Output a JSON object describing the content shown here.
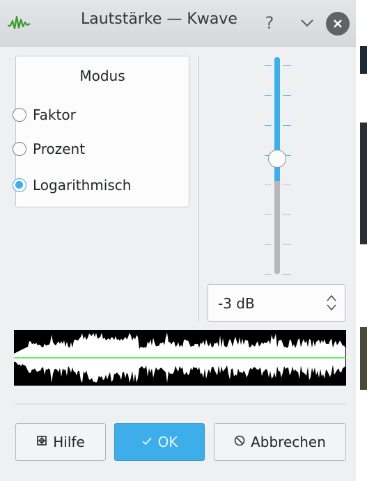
{
  "window": {
    "title": "Lautstärke — Kwave",
    "help_symbol": "?",
    "minimize_symbol": "⌄",
    "close_symbol": "✕",
    "icon": "kwave-waveform-icon"
  },
  "mode_group": {
    "title": "Modus",
    "options": [
      {
        "label": "Faktor",
        "checked": false
      },
      {
        "label": "Prozent",
        "checked": false
      },
      {
        "label": "Logarithmisch",
        "checked": true
      }
    ]
  },
  "slider": {
    "level_fraction": 0.57,
    "accent_color": "#3daee9"
  },
  "spinbox": {
    "value": "-3 dB"
  },
  "waveform": {
    "background": "#000000",
    "wave_color": "#ffffff",
    "center_line_color": "#2ee82e"
  },
  "buttons": {
    "help": {
      "label": "Hilfe",
      "icon": "lifebuoy-icon"
    },
    "ok": {
      "label": "OK",
      "icon": "checkmark-icon"
    },
    "cancel": {
      "label": "Abbrechen",
      "icon": "cancel-icon"
    }
  }
}
